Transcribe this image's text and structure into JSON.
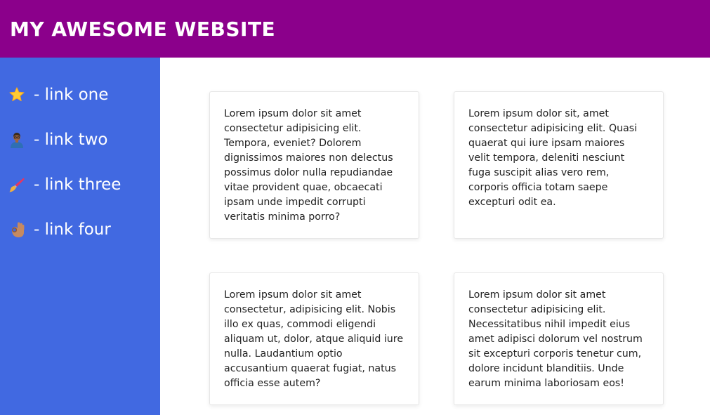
{
  "header": {
    "title": "MY AWESOME WEBSITE",
    "background_color": "#8b008b"
  },
  "sidebar": {
    "background_color": "#4169e1",
    "items": [
      {
        "icon": "star-icon",
        "label": "- link one"
      },
      {
        "icon": "person-icon",
        "label": "- link two"
      },
      {
        "icon": "paintbrush-icon",
        "label": "- link three"
      },
      {
        "icon": "ok-hand-icon",
        "label": "- link four"
      }
    ]
  },
  "main": {
    "cards": [
      {
        "text": "Lorem ipsum dolor sit amet consectetur adipisicing elit. Tempora, eveniet? Dolorem dignissimos maiores non delectus possimus dolor nulla repudiandae vitae provident quae, obcaecati ipsam unde impedit corrupti veritatis minima porro?"
      },
      {
        "text": "Lorem ipsum dolor sit, amet consectetur adipisicing elit. Quasi quaerat qui iure ipsam maiores velit tempora, deleniti nesciunt fuga suscipit alias vero rem, corporis officia totam saepe excepturi odit ea."
      },
      {
        "text": "Lorem ipsum dolor sit amet consectetur, adipisicing elit. Nobis illo ex quas, commodi eligendi aliquam ut, dolor, atque aliquid iure nulla. Laudantium optio accusantium quaerat fugiat, natus officia esse autem?"
      },
      {
        "text": "Lorem ipsum dolor sit amet consectetur adipisicing elit. Necessitatibus nihil impedit eius amet adipisci dolorum vel nostrum sit excepturi corporis tenetur cum, dolore incidunt blanditiis. Unde earum minima laboriosam eos!"
      }
    ]
  }
}
